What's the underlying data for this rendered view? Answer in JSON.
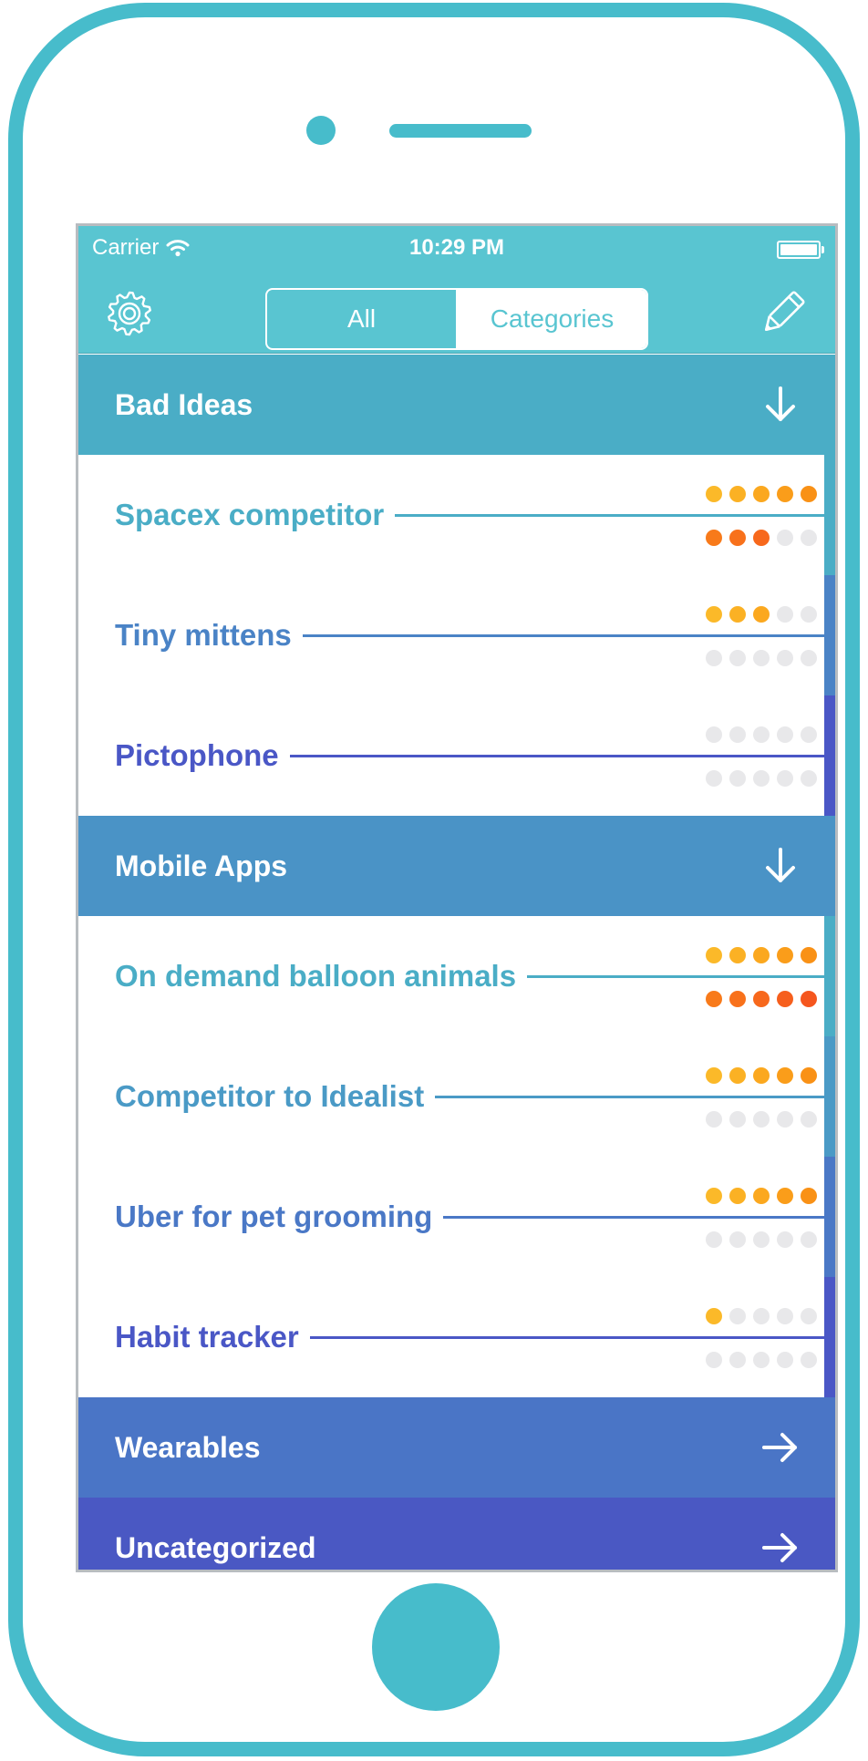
{
  "colors": {
    "frame": "#47bccb",
    "navbar": "#59c5d1",
    "dot_empty": "#e8e8ea",
    "dot_top": [
      "#fbb929",
      "#fbb124",
      "#fba81f",
      "#fa9d1a",
      "#f99116"
    ],
    "dot_bottom": [
      "#f87a1a",
      "#f8711b",
      "#f7681c",
      "#f65f1d",
      "#f5561e"
    ]
  },
  "status_bar": {
    "carrier": "Carrier",
    "time": "10:29 PM",
    "wifi_icon": "wifi-icon",
    "battery_icon": "battery-icon"
  },
  "nav_bar": {
    "settings_icon": "gear-icon",
    "edit_icon": "pencil-icon",
    "segments": [
      {
        "label": "All",
        "selected": false
      },
      {
        "label": "Categories",
        "selected": true
      }
    ]
  },
  "categories": [
    {
      "name": "Bad Ideas",
      "color": "#4aadc6",
      "expanded": true,
      "arrow_icon": "arrow-down-icon",
      "ideas": [
        {
          "title": "Spacex competitor",
          "color": "#4aadc6",
          "top_rating": 5,
          "bottom_rating": 3
        },
        {
          "title": "Tiny mittens",
          "color": "#4a83c6",
          "top_rating": 3,
          "bottom_rating": 0
        },
        {
          "title": "Pictophone",
          "color": "#4a57c6",
          "top_rating": 0,
          "bottom_rating": 0
        }
      ]
    },
    {
      "name": "Mobile Apps",
      "color": "#4a93c6",
      "expanded": true,
      "arrow_icon": "arrow-down-icon",
      "ideas": [
        {
          "title": "On demand balloon animals",
          "color": "#4aadc6",
          "top_rating": 5,
          "bottom_rating": 5
        },
        {
          "title": "Competitor to Idealist",
          "color": "#4a9ac6",
          "top_rating": 5,
          "bottom_rating": 0
        },
        {
          "title": "Uber for pet grooming",
          "color": "#4a78c6",
          "top_rating": 5,
          "bottom_rating": 0
        },
        {
          "title": "Habit tracker",
          "color": "#4a57c6",
          "top_rating": 1,
          "bottom_rating": 0
        }
      ]
    },
    {
      "name": "Wearables",
      "color": "#4a75c6",
      "expanded": false,
      "arrow_icon": "arrow-right-icon",
      "ideas": []
    },
    {
      "name": "Uncategorized",
      "color": "#4a58c3",
      "expanded": false,
      "arrow_icon": "arrow-right-icon",
      "ideas": []
    }
  ]
}
